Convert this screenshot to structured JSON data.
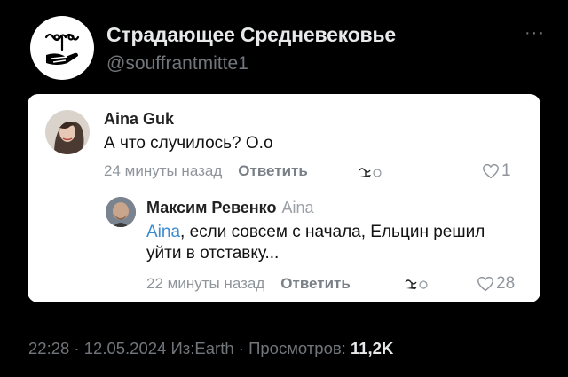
{
  "author": {
    "display_name": "Страдающее Средневековье",
    "handle": "@souffrantmitte1",
    "avatar_icon": "medieval-hand-flower-logo"
  },
  "more_icon": "more-dots-icon",
  "screenshot": {
    "comments": [
      {
        "author": "Aina Guk",
        "text": "А что случилось? О.о",
        "time": "24 минуты назад",
        "reply_label": "Ответить",
        "likes": "1"
      },
      {
        "author": "Максим Ревенко",
        "reply_to": "Aina",
        "mention": "Aina",
        "text": ", если совсем с начала, Ельцин решил уйти в отставку...",
        "time": "22 минуты назад",
        "reply_label": "Ответить",
        "likes": "28"
      }
    ]
  },
  "footer": {
    "time": "22:28",
    "separator": " · ",
    "date": "12.05.2024",
    "source": "Из:Earth",
    "views_label": "Просмотров: ",
    "views": "11,2K"
  },
  "colors": {
    "background": "#000000",
    "card": "#ffffff",
    "muted": "#71767b",
    "mention": "#3a8bd0"
  }
}
